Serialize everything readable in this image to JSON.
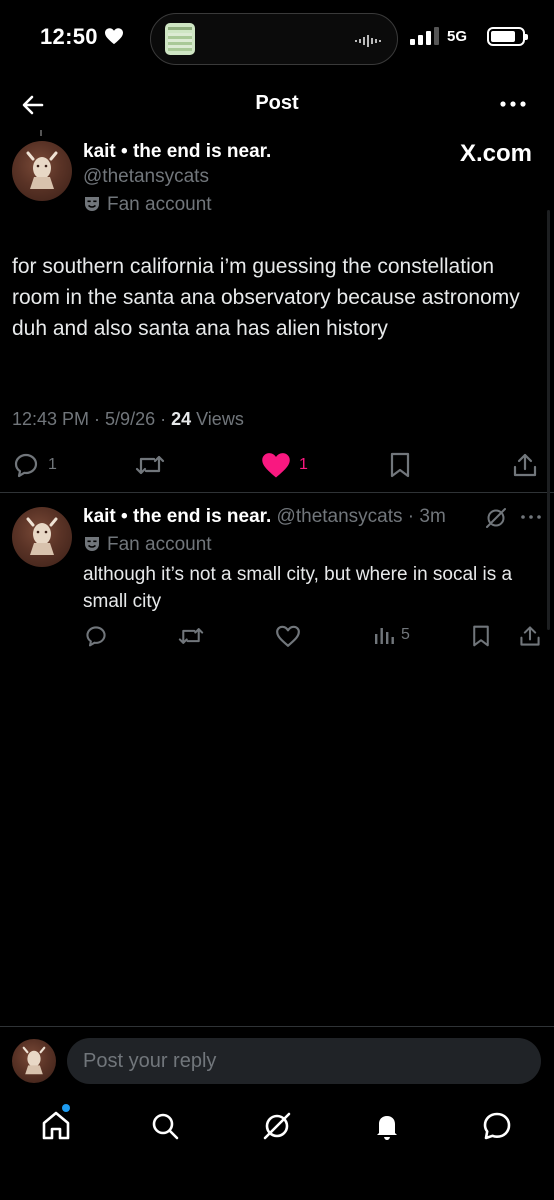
{
  "status_bar": {
    "time": "12:50",
    "network": "5G"
  },
  "header": {
    "title": "Post"
  },
  "main_post": {
    "display_name": "kait • the end is near.",
    "handle": "@thetansycats",
    "badge": "Fan account",
    "external_link": "X.com",
    "text": "for southern california i’m guessing the constellation room in the santa ana observatory because astronomy duh and also santa ana has alien history",
    "timestamp": "12:43 PM · 5/9/26 · ",
    "views_count": "24",
    "views_label": " Views",
    "replies": "1",
    "likes": "1",
    "liked": true,
    "like_color": "#f91880"
  },
  "reply": {
    "display_name": "kait • the end is near.",
    "handle_time": " @thetansycats · 3m",
    "badge": "Fan account",
    "text": "although it’s not a small city, but where in socal is a small city",
    "views": "5"
  },
  "composer": {
    "placeholder": "Post your reply"
  },
  "tabs": [
    {
      "name": "home",
      "icon": "home-icon",
      "has_notification_dot": true
    },
    {
      "name": "search",
      "icon": "search-icon"
    },
    {
      "name": "grok",
      "icon": "grok-icon"
    },
    {
      "name": "notifications",
      "icon": "bell-icon"
    },
    {
      "name": "messages",
      "icon": "chat-icon"
    }
  ],
  "colors": {
    "background": "#000000",
    "text_primary": "#e7e9ea",
    "text_secondary": "#71767b",
    "divider": "#2f3336",
    "accent_blue": "#1d9bf0",
    "like_pink": "#f91880"
  }
}
